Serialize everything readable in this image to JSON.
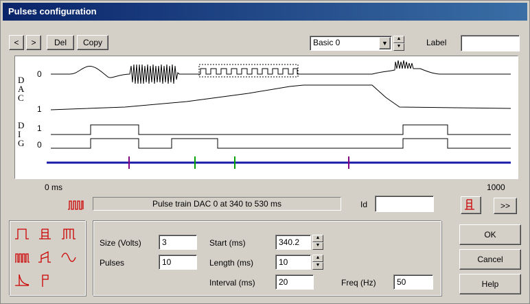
{
  "window": {
    "title": "Pulses configuration"
  },
  "toolbar": {
    "prev_label": "<",
    "next_label": ">",
    "del_label": "Del",
    "copy_label": "Copy",
    "preset_value": "Basic 0",
    "label_caption": "Label",
    "label_value": ""
  },
  "plot": {
    "y_letters_dac": [
      "D",
      "A",
      "C"
    ],
    "y_letters_dig": [
      "D",
      "I",
      "G"
    ],
    "dac_rows": [
      "0",
      "1"
    ],
    "dig_rows": [
      "1",
      "0"
    ],
    "x_start": "0 ms",
    "x_end": "1000"
  },
  "status": {
    "description": "Pulse train DAC 0 at 340 to 530 ms",
    "id_label": "Id",
    "id_value": "",
    "more_label": ">>"
  },
  "params": {
    "size_label": "Size (Volts)",
    "size_value": "3",
    "pulses_label": "Pulses",
    "pulses_value": "10",
    "start_label": "Start (ms)",
    "start_value": "340.2",
    "length_label": "Length (ms)",
    "length_value": "10",
    "interval_label": "Interval (ms)",
    "interval_value": "20",
    "freq_label": "Freq (Hz)",
    "freq_value": "50"
  },
  "actions": {
    "ok_label": "OK",
    "cancel_label": "Cancel",
    "help_label": "Help"
  },
  "icons": [
    "step-pulse-icon",
    "pulse-stack-icon",
    "wide-pulse-icon",
    "pulse-train-icon",
    "ramp-icon",
    "sine-icon",
    "exponential-icon",
    "digital-marker-icon"
  ],
  "colors": {
    "accent": "#cc0000",
    "timeline": "#1a1aa8",
    "marker_purple": "#800080",
    "marker_green": "#00a000",
    "title_start": "#0a246a"
  }
}
